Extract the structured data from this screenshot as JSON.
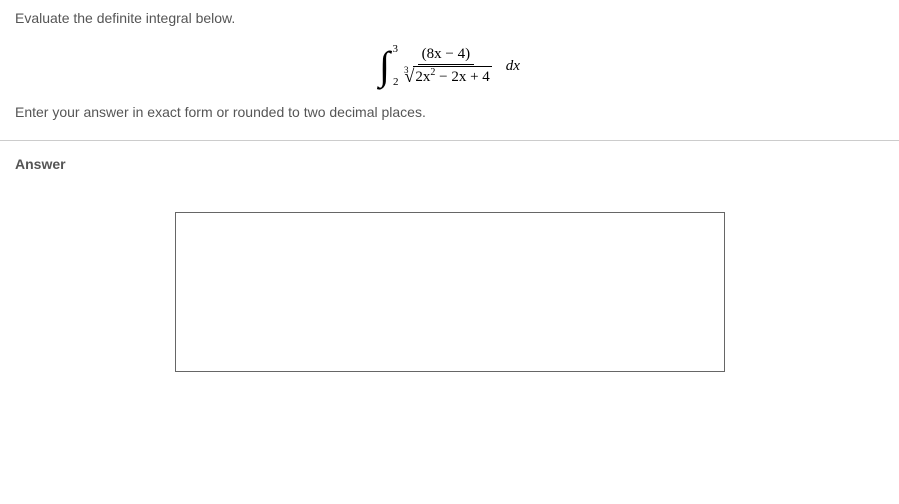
{
  "question": {
    "prompt": "Evaluate the definite integral below.",
    "instruction": "Enter your answer in exact form or rounded to two decimal places.",
    "integral": {
      "lower_bound": "2",
      "upper_bound": "3",
      "numerator": "(8x − 4)",
      "root_index": "3",
      "radicand_pre": "2x",
      "radicand_exp": "2",
      "radicand_post": " − 2x + 4",
      "differential": "dx"
    }
  },
  "answer": {
    "label": "Answer",
    "value": ""
  }
}
